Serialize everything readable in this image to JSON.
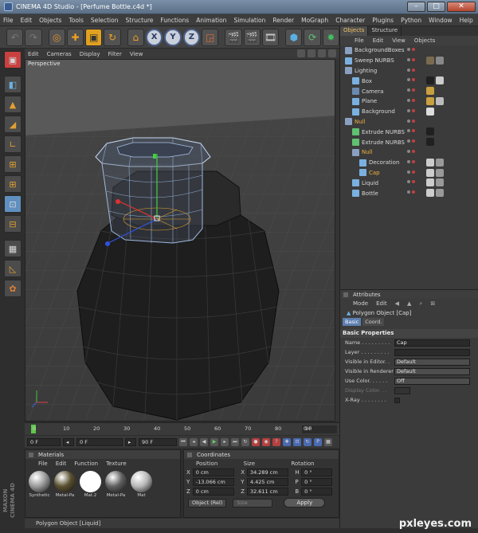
{
  "window": {
    "title": "CINEMA 4D Studio - [Perfume Bottle.c4d *]",
    "min": "–",
    "max": "□",
    "close": "✕"
  },
  "menubar": [
    "File",
    "Edit",
    "Objects",
    "Tools",
    "Selection",
    "Structure",
    "Functions",
    "Animation",
    "Simulation",
    "Render",
    "MoGraph",
    "Character",
    "Plugins",
    "Python",
    "Window",
    "Help"
  ],
  "toolbar": {
    "axes": [
      "X",
      "Y",
      "Z"
    ]
  },
  "viewport": {
    "menu": [
      "Edit",
      "Cameras",
      "Display",
      "Filter",
      "View"
    ],
    "label": "Perspective"
  },
  "timeline": {
    "ticks": [
      "0",
      "10",
      "20",
      "30",
      "40",
      "50",
      "60",
      "70",
      "80",
      "90"
    ],
    "current_frame": "0 F"
  },
  "transport": {
    "start": "0 F",
    "min": "0 F",
    "max": "90 F",
    "end": "90 F"
  },
  "materials": {
    "title": "Materials",
    "menu": [
      "File",
      "Edit",
      "Function",
      "Texture"
    ],
    "items": [
      {
        "label": "Synthetic",
        "color": "#9a9a9a"
      },
      {
        "label": "Metal-Pa",
        "color": "#5a5030"
      },
      {
        "label": "Mat.2",
        "color": "#ffffff"
      },
      {
        "label": "Metal-Pa",
        "color": "#606060"
      },
      {
        "label": "Mat",
        "color": "#b8b8b8"
      }
    ]
  },
  "coordinates": {
    "title": "Coordinates",
    "headers": [
      "Position",
      "Size",
      "Rotation"
    ],
    "rows": [
      {
        "axis": "X",
        "pos": "0 cm",
        "size": "34.289 cm",
        "rot_axis": "H",
        "rot": "0 °"
      },
      {
        "axis": "Y",
        "pos": "-13.066 cm",
        "size": "4.425 cm",
        "rot_axis": "P",
        "rot": "0 °"
      },
      {
        "axis": "Z",
        "pos": "0 cm",
        "size": "32.611 cm",
        "rot_axis": "B",
        "rot": "0 °"
      }
    ],
    "mode": "Object (Rel)",
    "size_mode": "Size",
    "apply": "Apply"
  },
  "status": "Polygon Object [Liquid]",
  "brand": "MAXON CINEMA 4D",
  "objects": {
    "tabs": [
      "Objects",
      "Structure"
    ],
    "menu": [
      "File",
      "Edit",
      "View",
      "Objects"
    ],
    "rows": [
      {
        "name": "BackgroundBoxes",
        "indent": 0,
        "icon": "#8aa0c0",
        "tags": []
      },
      {
        "name": "Sweep NURBS",
        "indent": 0,
        "icon": "#7ab0e0",
        "tags": [
          "#7a6a50",
          "#888888"
        ]
      },
      {
        "name": "Lighting",
        "indent": 0,
        "icon": "#8aa0c0",
        "tags": []
      },
      {
        "name": "Box",
        "indent": 1,
        "icon": "#7ab0e0",
        "tags": [
          "#202020",
          "#cccccc"
        ]
      },
      {
        "name": "Camera",
        "indent": 1,
        "icon": "#6a8ab0",
        "tags": [
          "#c8a040"
        ]
      },
      {
        "name": "Plane",
        "indent": 1,
        "icon": "#7ab0e0",
        "tags": [
          "#c8a040",
          "#bbbbbb"
        ]
      },
      {
        "name": "Background",
        "indent": 1,
        "icon": "#7ab0e0",
        "tags": [
          "#dddddd"
        ]
      },
      {
        "name": "Null",
        "indent": 0,
        "icon": "#8aa0c0",
        "tags": [],
        "null": true
      },
      {
        "name": "Extrude NURBS",
        "indent": 1,
        "icon": "#60c070",
        "tags": [
          "#202020"
        ]
      },
      {
        "name": "Extrude NURBS",
        "indent": 1,
        "icon": "#60c070",
        "tags": [
          "#202020"
        ]
      },
      {
        "name": "Null",
        "indent": 1,
        "icon": "#8aa0c0",
        "tags": [],
        "null": true
      },
      {
        "name": "Decoration",
        "indent": 2,
        "icon": "#7ab0e0",
        "tags": [
          "#cccccc",
          "#999999"
        ]
      },
      {
        "name": "Cap",
        "indent": 2,
        "icon": "#7ab0e0",
        "tags": [
          "#cccccc",
          "#999999"
        ],
        "selected": true
      },
      {
        "name": "Liquid",
        "indent": 1,
        "icon": "#7ab0e0",
        "tags": [
          "#cccccc",
          "#999999"
        ]
      },
      {
        "name": "Bottle",
        "indent": 1,
        "icon": "#7ab0e0",
        "tags": [
          "#cccccc",
          "#999999"
        ]
      }
    ]
  },
  "attributes": {
    "title": "Attributes",
    "menu": [
      "Mode",
      "Edit"
    ],
    "object": "Polygon Object [Cap]",
    "tabs": [
      "Basic",
      "Coord."
    ],
    "section": "Basic Properties",
    "fields": [
      {
        "label": "Name . . . . . . . . .",
        "value": "Cap",
        "type": "text"
      },
      {
        "label": "Layer . . . . . . . . .",
        "value": "",
        "type": "text"
      },
      {
        "label": "Visible in Editor. .",
        "value": "Default",
        "type": "dropdown"
      },
      {
        "label": "Visible in Renderer",
        "value": "Default",
        "type": "dropdown"
      },
      {
        "label": "Use Color. . . . . .",
        "value": "Off",
        "type": "dropdown"
      },
      {
        "label": "Display Color. . .",
        "value": "",
        "type": "dim"
      },
      {
        "label": "X-Ray . . . . . . . .",
        "value": "",
        "type": "check"
      }
    ]
  },
  "watermark": "pxleyes.com"
}
